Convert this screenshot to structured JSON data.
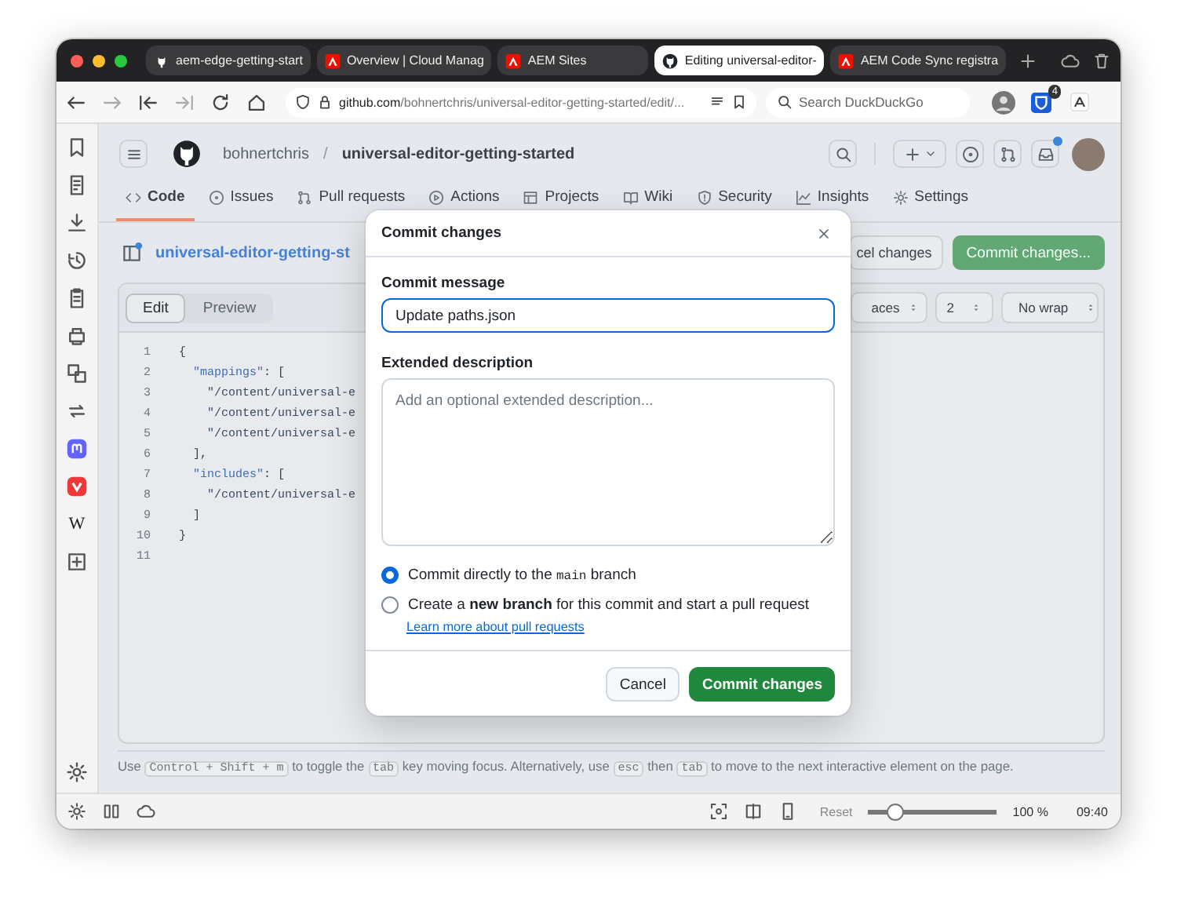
{
  "browser": {
    "tabs": [
      {
        "title": "aem-edge-getting-start",
        "kind": "github",
        "selected": false
      },
      {
        "title": "Overview | Cloud Manag",
        "kind": "adobe",
        "selected": false
      },
      {
        "title": "AEM Sites",
        "kind": "adobe",
        "selected": false
      },
      {
        "title": "Editing universal-editor-",
        "kind": "github",
        "selected": true
      },
      {
        "title": "AEM Code Sync registra",
        "kind": "adobe",
        "selected": false
      }
    ],
    "url": {
      "host": "github.com",
      "path": "/bohnertchris/universal-editor-getting-started/edit/..."
    },
    "search": {
      "placeholder": "Search DuckDuckGo"
    },
    "extension_badge": "4"
  },
  "sidebar": {
    "wiki_letter": "W"
  },
  "github": {
    "owner": "bohnertchris",
    "separator": "/",
    "repo": "universal-editor-getting-started",
    "inbox_unread": true,
    "nav": [
      {
        "label": "Code",
        "selected": true
      },
      {
        "label": "Issues",
        "selected": false
      },
      {
        "label": "Pull requests",
        "selected": false
      },
      {
        "label": "Actions",
        "selected": false
      },
      {
        "label": "Projects",
        "selected": false
      },
      {
        "label": "Wiki",
        "selected": false
      },
      {
        "label": "Security",
        "selected": false
      },
      {
        "label": "Insights",
        "selected": false
      },
      {
        "label": "Settings",
        "selected": false
      }
    ],
    "file_name": "universal-editor-getting-st",
    "cancel_button": "cel changes",
    "commit_button": "Commit changes...",
    "editor": {
      "tabs": [
        {
          "label": "Edit",
          "selected": true
        },
        {
          "label": "Preview",
          "selected": false
        }
      ],
      "selects": [
        "aces",
        "2",
        "No wrap"
      ],
      "lines": [
        {
          "number": "1",
          "parts": [
            {
              "text": "{",
              "kind": "plain"
            }
          ]
        },
        {
          "number": "2",
          "parts": [
            {
              "text": "  \"mappings\"",
              "kind": "key"
            },
            {
              "text": ": [",
              "kind": "plain"
            }
          ]
        },
        {
          "number": "3",
          "parts": [
            {
              "text": "    \"/content/universal-e",
              "kind": "string"
            }
          ]
        },
        {
          "number": "4",
          "parts": [
            {
              "text": "    \"/content/universal-e",
              "kind": "string"
            }
          ]
        },
        {
          "number": "5",
          "parts": [
            {
              "text": "    \"/content/universal-e",
              "kind": "string"
            }
          ]
        },
        {
          "number": "6",
          "parts": [
            {
              "text": "  ],",
              "kind": "plain"
            }
          ]
        },
        {
          "number": "7",
          "parts": [
            {
              "text": "  \"includes\"",
              "kind": "key"
            },
            {
              "text": ": [",
              "kind": "plain"
            }
          ]
        },
        {
          "number": "8",
          "parts": [
            {
              "text": "    \"/content/universal-e",
              "kind": "string"
            }
          ]
        },
        {
          "number": "9",
          "parts": [
            {
              "text": "  ]",
              "kind": "plain"
            }
          ]
        },
        {
          "number": "10",
          "parts": [
            {
              "text": "}",
              "kind": "plain"
            }
          ]
        },
        {
          "number": "11"
        }
      ]
    },
    "hint": [
      {
        "text": "Use ",
        "kind": "text"
      },
      {
        "text": "Control + Shift + m",
        "kind": "key"
      },
      {
        "text": " to toggle the ",
        "kind": "text"
      },
      {
        "text": "tab",
        "kind": "key"
      },
      {
        "text": " key moving focus. Alternatively, use ",
        "kind": "text"
      },
      {
        "text": "esc",
        "kind": "key"
      },
      {
        "text": " then ",
        "kind": "text"
      },
      {
        "text": "tab",
        "kind": "key"
      },
      {
        "text": " to move to the next interactive element on the page.",
        "kind": "text"
      }
    ]
  },
  "dialog": {
    "title": "Commit changes",
    "message_label": "Commit message",
    "message_value": "Update paths.json",
    "description_label": "Extended description",
    "description_placeholder": "Add an optional extended description...",
    "options": [
      {
        "selected": true,
        "parts": [
          {
            "text": "Commit directly to the ",
            "kind": "text"
          },
          {
            "text": "main",
            "kind": "code"
          },
          {
            "text": " branch",
            "kind": "text"
          }
        ]
      },
      {
        "selected": false,
        "parts": [
          {
            "text": "Create a ",
            "kind": "text"
          },
          {
            "text": "new branch",
            "kind": "bold"
          },
          {
            "text": " for this commit and start a pull request",
            "kind": "text"
          }
        ]
      }
    ],
    "link": "Learn more about pull requests",
    "cancel": "Cancel",
    "submit": "Commit changes"
  },
  "status_bar": {
    "reset": "Reset",
    "zoom": {
      "level": 0.2
    },
    "zoom_reading": "100 %",
    "time": "09:40"
  }
}
